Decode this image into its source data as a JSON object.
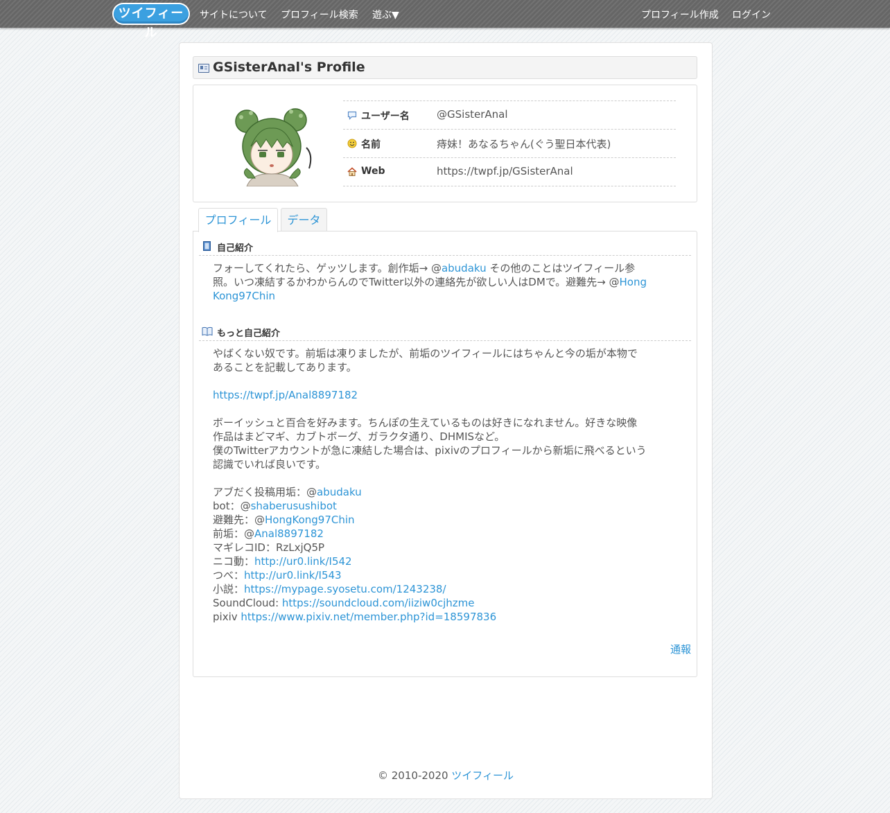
{
  "nav": {
    "logo": "ツイフィール",
    "links": [
      "サイトについて",
      "プロフィール検索",
      "遊ぶ▼"
    ],
    "right_links": [
      "プロフィール作成",
      "ログイン"
    ]
  },
  "page_title": "GSisterAnal's Profile",
  "profile": {
    "username_label": "ユーザー名",
    "username": "@GSisterAnal",
    "name_label": "名前",
    "name": "痔妹！あなるちゃん(ぐう聖日本代表)",
    "web_label": "Web",
    "web": "https://twpf.jp/GSisterAnal"
  },
  "tabs": [
    "プロフィール",
    "データ"
  ],
  "intro": {
    "heading": "自己紹介",
    "lines": [
      [
        "フォーしてくれたら、ゲッツします。創作垢→ @",
        "abudaku",
        " その他のことはツイフィール参"
      ],
      [
        "照。いつ凍結するかわからんのでTwitter以外の連絡先が欲しい人はDMで。避難先→ @",
        "Hong"
      ],
      [
        "",
        "Kong97Chin"
      ]
    ]
  },
  "more_intro": {
    "heading": "もっと自己紹介",
    "lines": [
      [
        "やばくない奴です。前垢は凍りましたが、前垢のツイフィールにはちゃんと今の垢が本物で"
      ],
      [
        "あることを記載してあります。"
      ],
      [
        ""
      ],
      [
        "",
        "https://twpf.jp/Anal8897182"
      ],
      [
        ""
      ],
      [
        "ボーイッシュと百合を好みます。ちんぽの生えているものは好きになれません。好きな映像"
      ],
      [
        "作品はまどマギ、カブトボーグ、ガラクタ通り、DHMISなど。"
      ],
      [
        "僕のTwitterアカウントが急に凍結した場合は、pixivのプロフィールから新垢に飛べるという"
      ],
      [
        "認識でいれば良いです。"
      ],
      [
        ""
      ],
      [
        "アブだく投稿用垢：@",
        "abudaku"
      ],
      [
        "bot：@",
        "shaberusushibot"
      ],
      [
        "避難先：@",
        "HongKong97Chin"
      ],
      [
        "前垢：@",
        "Anal8897182"
      ],
      [
        "マギレコID：RzLxjQ5P"
      ],
      [
        "ニコ動：",
        "http://ur0.link/I542"
      ],
      [
        "つべ：",
        "http://ur0.link/I543"
      ],
      [
        "小説：",
        "https://mypage.syosetu.com/1243238/"
      ],
      [
        "SoundCloud: ",
        "https://soundcloud.com/iiziw0cjhzme"
      ],
      [
        "pixiv ",
        "https://www.pixiv.net/member.php?id=18597836"
      ]
    ]
  },
  "report": "通報",
  "footer": {
    "copyright": "© 2010-2020 ",
    "link": "ツイフィール"
  },
  "colors": {
    "link": "#2c94d6",
    "navbar": "#6b6b6b",
    "logo": "#3ba0e0"
  }
}
